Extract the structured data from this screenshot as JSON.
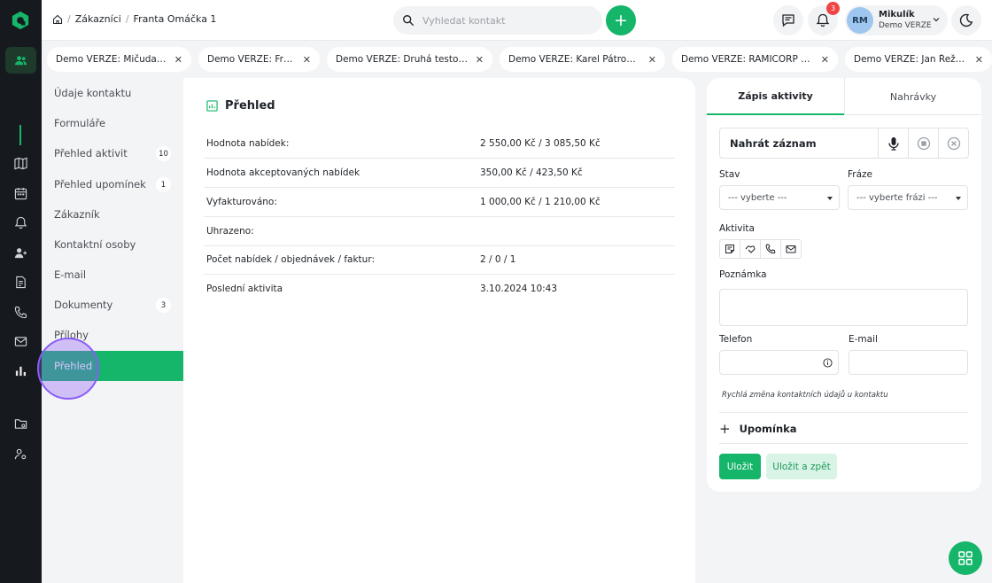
{
  "breadcrumb": {
    "items": [
      "Zákazníci",
      "Franta Omáčka 1"
    ]
  },
  "search": {
    "placeholder": "Vyhledat kontakt"
  },
  "notifications": {
    "count": "3"
  },
  "user": {
    "initials": "RM",
    "name": "Mikulík",
    "org": "Demo VERZE"
  },
  "contact_tabs": [
    {
      "label": "Demo VERZE: Mičuda a.s."
    },
    {
      "label": "Demo VERZE: Franta"
    },
    {
      "label": "Demo VERZE: Druhá testova..."
    },
    {
      "label": "Demo VERZE: Karel Pátrovič..."
    },
    {
      "label": "Demo VERZE: RAMICORP s.r..."
    },
    {
      "label": "Demo VERZE: Jan Řežábek"
    }
  ],
  "menu": {
    "items": [
      {
        "label": "Údaje kontaktu",
        "count": ""
      },
      {
        "label": "Formuláře",
        "count": ""
      },
      {
        "label": "Přehled aktivit",
        "count": "10"
      },
      {
        "label": "Přehled upomínek",
        "count": "1"
      },
      {
        "label": "Zákazník",
        "count": ""
      },
      {
        "label": "Kontaktní osoby",
        "count": ""
      },
      {
        "label": "E-mail",
        "count": ""
      },
      {
        "label": "Dokumenty",
        "count": "3"
      },
      {
        "label": "Přílohy",
        "count": ""
      },
      {
        "label": "Přehled",
        "count": ""
      }
    ]
  },
  "overview": {
    "title": "Přehled",
    "rows": [
      {
        "key": "Hodnota nabídek:",
        "value": "2 550,00 Kč / 3 085,50 Kč"
      },
      {
        "key": "Hodnota akceptovaných nabídek",
        "value": "350,00 Kč / 423,50 Kč"
      },
      {
        "key": "Vyfakturováno:",
        "value": "1 000,00 Kč / 1 210,00 Kč"
      },
      {
        "key": "Uhrazeno:",
        "value": ""
      },
      {
        "key": "Počet nabídek / objednávek / faktur:",
        "value": "2 / 0 / 1"
      },
      {
        "key": "Poslední aktivita",
        "value": "3.10.2024 10:43"
      }
    ]
  },
  "activity": {
    "tab_write": "Zápis aktivity",
    "tab_recordings": "Nahrávky",
    "record_label": "Nahrát záznam",
    "state_label": "Stav",
    "state_value": "--- vyberte ---",
    "phrase_label": "Fráze",
    "phrase_value": "--- vyberte frázi ---",
    "activity_label": "Aktivita",
    "note_label": "Poznámka",
    "phone_label": "Telefon",
    "email_label": "E-mail",
    "hint": "Rychlá změna kontaktních údajů u kontaktu",
    "reminder_label": "Upomínka",
    "save_label": "Uložit",
    "save_back_label": "Uložit a zpět"
  },
  "colors": {
    "accent": "#15b56a",
    "rail": "#16191d"
  }
}
